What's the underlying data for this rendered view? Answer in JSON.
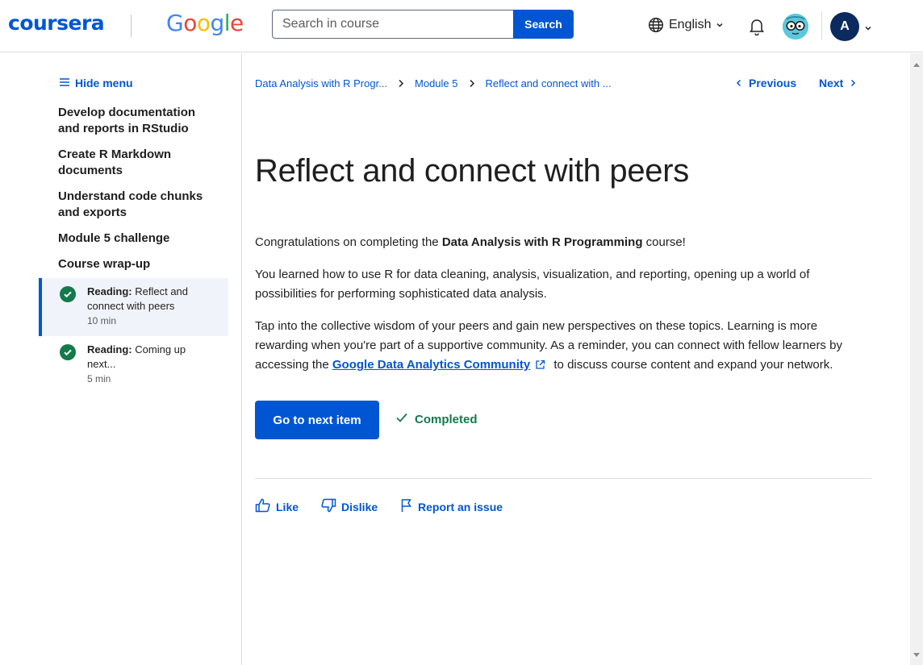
{
  "header": {
    "logo_text": "coursera",
    "partner_logo": "Google",
    "search": {
      "placeholder": "Search in course",
      "button_label": "Search"
    },
    "language": "English",
    "notifications_icon": "bell-icon",
    "avatar_initial": "A"
  },
  "sidebar": {
    "hide_menu_label": "Hide menu",
    "sections": [
      "Develop documentation and reports in RStudio",
      "Create R Markdown documents",
      "Understand code chunks and exports",
      "Module 5 challenge",
      "Course wrap-up"
    ],
    "items": [
      {
        "type": "Reading:",
        "title": "Reflect and connect with peers",
        "duration": "10 min",
        "status": "completed",
        "active": true
      },
      {
        "type": "Reading:",
        "title": "Coming up next...",
        "duration": "5 min",
        "status": "completed",
        "active": false
      }
    ]
  },
  "breadcrumb": [
    "Data Analysis with R Progr...",
    "Module 5",
    "Reflect and connect with ..."
  ],
  "nav": {
    "previous": "Previous",
    "next": "Next"
  },
  "content": {
    "title": "Reflect and connect with peers",
    "p1_before": "Congratulations on completing the ",
    "p1_bold": "Data Analysis with R Programming",
    "p1_after": " course!",
    "p2": "You learned how to use R for data cleaning, analysis, visualization, and reporting, opening up a world of possibilities for performing sophisticated data analysis.",
    "p3_before": "Tap into the collective wisdom of your peers and gain new perspectives on these topics. Learning is more rewarding when you're part of a supportive community. As a reminder,  you can connect with fellow learners by accessing the ",
    "p3_link": "Google Data Analytics Community",
    "p3_after": " to discuss course content and expand your network."
  },
  "actions": {
    "next_item_label": "Go to next item",
    "completed_label": "Completed"
  },
  "feedback": {
    "like": "Like",
    "dislike": "Dislike",
    "report": "Report an issue"
  },
  "colors": {
    "brand": "#0056d2",
    "success": "#137a4b",
    "avatar_bg": "#0b2a5e",
    "active_bg": "#f0f4fa"
  }
}
